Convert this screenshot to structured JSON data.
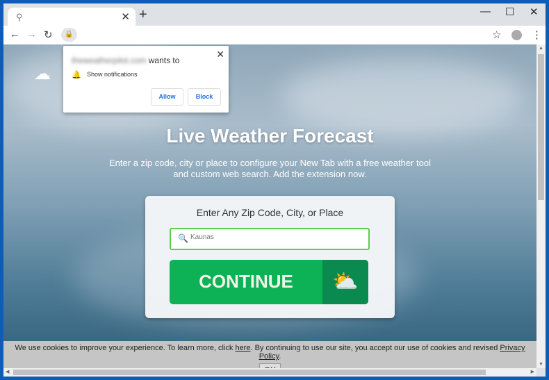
{
  "browser": {
    "tab_close": "✕",
    "new_tab": "+",
    "minimize": "—",
    "maximize": "☐",
    "close": "✕"
  },
  "popup": {
    "domain": "theweatherpilot.com",
    "wants_to": "wants to",
    "permission": "Show notifications",
    "allow": "Allow",
    "block": "Block",
    "close": "✕"
  },
  "page": {
    "title": "Live Weather Forecast",
    "subtitle": "Enter a zip code, city or place to configure your New Tab with a free weather tool and custom web search. Add the extension now.",
    "card_heading": "Enter Any Zip Code, City, or Place",
    "search_value": "Kaunas",
    "continue": "CONTINUE"
  },
  "cookie": {
    "text1": "We use cookies to improve your experience. To learn more, click ",
    "here": "here",
    "text2": ". By continuing to use our site, you accept our use of cookies and revised ",
    "policy": "Privacy Policy",
    "text3": ".",
    "ok": "OK"
  },
  "colors": {
    "accent": "#0db257",
    "frame": "#0d5db8"
  }
}
